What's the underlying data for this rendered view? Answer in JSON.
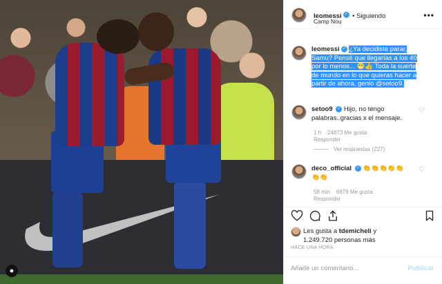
{
  "header": {
    "username": "leomessi",
    "follow_status": "• Siguiendo",
    "location": "Camp Nou",
    "more": "•••"
  },
  "caption": {
    "username": "leomessi",
    "line1": "¿Ya decidiste parar,",
    "line2": "Samu? Pensé que llegarías a los 40",
    "line3": "por lo menos... 😁👍 Toda la suerte",
    "line4": "de mundo en lo que quieras hacer a",
    "line5": "partir de ahora, genio @setoo9."
  },
  "comments": [
    {
      "username": "setoo9",
      "text_line1": "Hijo, no tengo",
      "text_line2": "palabras..gracias x el mensaje.",
      "time": "1 h",
      "likes": "24873 Me gusta",
      "reply": "Responder",
      "view_replies": "Ver respuestas (227)"
    },
    {
      "username": "deco_official",
      "text_line1": "👏👏👏👏👏",
      "text_line2": "👏👏",
      "time": "58 min",
      "likes": "6679 Me gusta",
      "reply": "Responder"
    }
  ],
  "likes": {
    "line1_prefix": "Les gusta a ",
    "line1_user": "tdemicheli",
    "line1_suffix": " y",
    "line2": "1.249.720 personas más"
  },
  "timestamp": "HACE UNA HORA",
  "comment_box": {
    "placeholder": "Añade un comentario...",
    "publish": "Publicar"
  },
  "icons": {
    "heart": "heart-icon",
    "comment": "comment-icon",
    "share": "share-icon",
    "bookmark": "bookmark-icon",
    "tag": "user-tag-icon"
  },
  "colors": {
    "verified": "#3897f0",
    "selection": "#3390ff",
    "publish": "#b2dffc",
    "muted": "#999999"
  }
}
